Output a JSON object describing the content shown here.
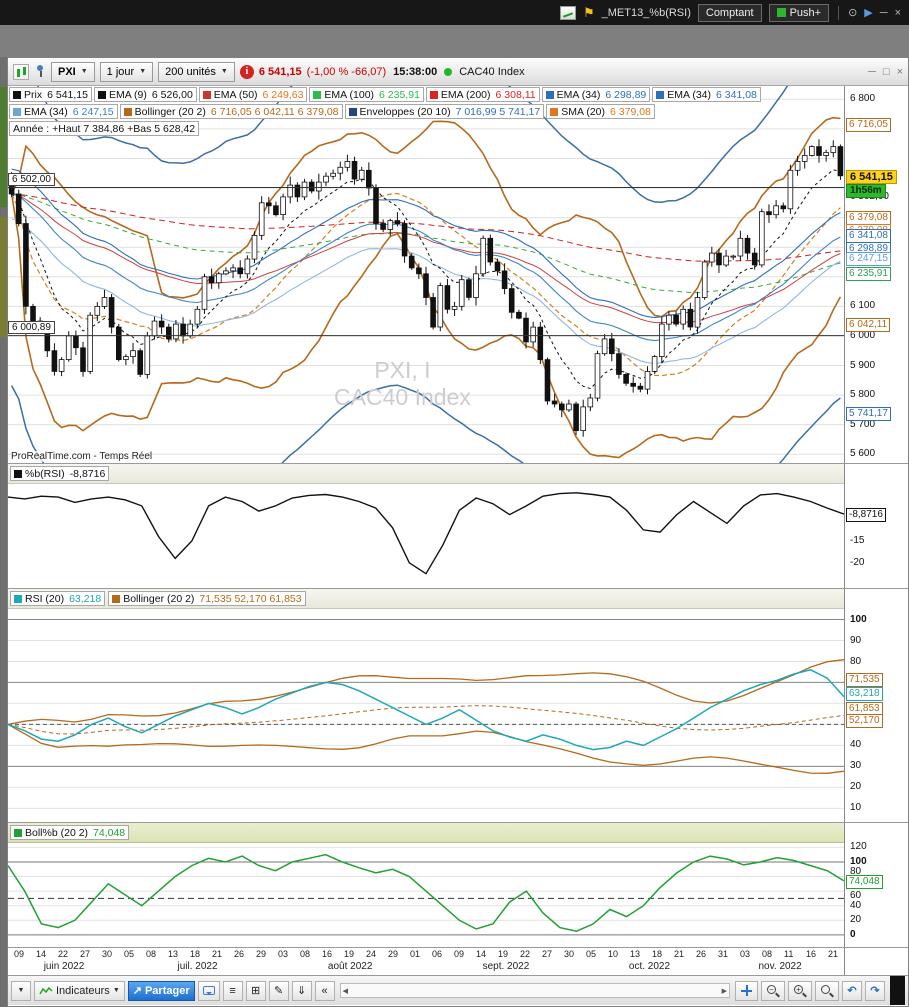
{
  "titlebar": {
    "workspace": "_MET13_%b(RSI)",
    "comptant": "Comptant",
    "push": "Push+"
  },
  "toolbar": {
    "symbol": "PXI",
    "period": "1 jour",
    "units": "200 unités",
    "price": "6 541,15",
    "change": "(-1,00 % -66,07)",
    "time": "15:38:00",
    "index": "CAC40 Index"
  },
  "legend": {
    "row1": [
      {
        "label": "Prix",
        "value": "6 541,15",
        "sq": "#111111",
        "vc": "#111111"
      },
      {
        "label": "EMA (9)",
        "value": "6 526,00",
        "sq": "#111111",
        "vc": "#111111"
      },
      {
        "label": "EMA (50)",
        "value": "6 249,63",
        "sq": "#cc3333",
        "vc": "#e07820"
      },
      {
        "label": "EMA (100)",
        "value": "6 235,91",
        "sq": "#2ebb4e",
        "vc": "#2ebb4e"
      },
      {
        "label": "EMA (200)",
        "value": "6 308,11",
        "sq": "#dd2222",
        "vc": "#dd2222"
      },
      {
        "label": "EMA (34)",
        "value": "6 298,89",
        "sq": "#2f6fba",
        "vc": "#2f6fba"
      },
      {
        "label": "EMA (34)",
        "value": "6 341,08",
        "sq": "#2f6fba",
        "vc": "#2f6fba"
      }
    ],
    "row2": [
      {
        "label": "EMA (34)",
        "value": "6 247,15",
        "sq": "#6aa6d8",
        "vc": "#3a7fc1"
      },
      {
        "label": "Bollinger (20 2)",
        "value": "6 716,05 6 042,11 6 379,08",
        "sq": "#b5691c",
        "vc": "#b5691c"
      },
      {
        "label": "Enveloppes (20 10)",
        "value": "7 016,99 5 741,17",
        "sq": "#24477e",
        "vc": "#2f6fba"
      },
      {
        "label": "SMA (20)",
        "value": "6 379,08",
        "sq": "#e07820",
        "vc": "#e07820"
      }
    ],
    "row3": "Année : +Haut 7 384,86 +Bas 5 628,42"
  },
  "panels": {
    "pb": {
      "label": "%b(RSI)",
      "value": "-8,8716",
      "sq": "#111111",
      "vc": "#111111"
    },
    "rsi": [
      {
        "label": "RSI (20)",
        "value": "63,218",
        "sq": "#1fa8b8",
        "vc": "#1fa8b8"
      },
      {
        "label": "Bollinger (20 2)",
        "value": "71,535 52,170 61,853",
        "sq": "#b5691c",
        "vc": "#b5691c"
      }
    ],
    "bollb": {
      "label": "Boll%b (20 2)",
      "value": "74,048",
      "sq": "#22a033",
      "vc": "#22a033"
    }
  },
  "axes": {
    "main": [
      {
        "text": "6 800",
        "value": 6800,
        "type": "plain"
      },
      {
        "text": "6 716,05",
        "value": 6716.05,
        "type": "chip",
        "color": "#b5691c"
      },
      {
        "text": "6 541,15",
        "value": 6541.15,
        "type": "price"
      },
      {
        "text": "1h56m",
        "value": 6541.15,
        "type": "time",
        "dy": 14
      },
      {
        "text": "6 502,00",
        "value": 6502,
        "type": "plain",
        "dy": 9
      },
      {
        "text": "6 379,08",
        "value": 6379.08,
        "type": "chip",
        "color": "#b5691c",
        "dy": -7
      },
      {
        "text": "6 379,08",
        "value": 6379.08,
        "type": "chip",
        "color": "#e07820",
        "dy": 6
      },
      {
        "text": "6 341,08",
        "value": 6341.08,
        "type": "chip",
        "color": "#2f6fba"
      },
      {
        "text": "6 298,89",
        "value": 6298.89,
        "type": "chip",
        "color": "#2f6fba"
      },
      {
        "text": "6 247,15",
        "value": 6247.15,
        "type": "chip",
        "color": "#5b9bd5",
        "dy": -5
      },
      {
        "text": "6 235,91",
        "value": 6235.91,
        "type": "chip",
        "color": "#2e9e5b",
        "dy": 7
      },
      {
        "text": "6 100",
        "value": 6100,
        "type": "plain"
      },
      {
        "text": "6 042,11",
        "value": 6042.11,
        "type": "chip",
        "color": "#b5691c"
      },
      {
        "text": "6 000",
        "value": 6000,
        "type": "plain"
      },
      {
        "text": "5 900",
        "value": 5900,
        "type": "plain"
      },
      {
        "text": "5 800",
        "value": 5800,
        "type": "plain"
      },
      {
        "text": "5 741,17",
        "value": 5741.17,
        "type": "chip",
        "color": "#2f6fba"
      },
      {
        "text": "5 700",
        "value": 5700,
        "type": "plain"
      },
      {
        "text": "5 600",
        "value": 5600,
        "type": "plain"
      }
    ],
    "pb": [
      {
        "text": "-8,8716",
        "value": -8.8716,
        "type": "chip",
        "color": "#111111"
      },
      {
        "text": "-15",
        "value": -15,
        "type": "plain"
      },
      {
        "text": "-20",
        "value": -20,
        "type": "plain"
      }
    ],
    "rsi": [
      {
        "text": "100",
        "value": 100,
        "type": "plain",
        "bold": true
      },
      {
        "text": "90",
        "value": 90,
        "type": "plain"
      },
      {
        "text": "80",
        "value": 80,
        "type": "plain"
      },
      {
        "text": "71,535",
        "value": 71.535,
        "type": "chip",
        "color": "#b5691c"
      },
      {
        "text": "63,218",
        "value": 63.218,
        "type": "chip",
        "color": "#1fa8b8",
        "dy": -4
      },
      {
        "text": "61,853",
        "value": 61.853,
        "type": "chip",
        "color": "#b5691c",
        "dy": 8
      },
      {
        "text": "52,170",
        "value": 52.17,
        "type": "chip",
        "color": "#b5691c"
      },
      {
        "text": "40",
        "value": 40,
        "type": "plain"
      },
      {
        "text": "30",
        "value": 30,
        "type": "plain"
      },
      {
        "text": "20",
        "value": 20,
        "type": "plain"
      },
      {
        "text": "10",
        "value": 10,
        "type": "plain"
      }
    ],
    "bollb": [
      {
        "text": "120",
        "value": 120,
        "type": "plain"
      },
      {
        "text": "100",
        "value": 100,
        "type": "plain",
        "bold": true
      },
      {
        "text": "80",
        "value": 80,
        "type": "plain",
        "dy": -5
      },
      {
        "text": "74,048",
        "value": 74.048,
        "type": "chip",
        "color": "#22a033"
      },
      {
        "text": "60",
        "value": 60,
        "type": "plain",
        "dy": 5
      },
      {
        "text": "40",
        "value": 40,
        "type": "plain"
      },
      {
        "text": "20",
        "value": 20,
        "type": "plain"
      },
      {
        "text": "0",
        "value": 0,
        "type": "plain",
        "bold": true
      }
    ]
  },
  "watermark": {
    "l1": "PXI, I",
    "l2": "CAC40 Index",
    "credit": "ProRealTime.com - Temps Réel"
  },
  "xaxis": {
    "ticks": [
      "09",
      "14",
      "22",
      "27",
      "30",
      "05",
      "08",
      "13",
      "18",
      "21",
      "26",
      "29",
      "03",
      "08",
      "16",
      "19",
      "24",
      "29",
      "01",
      "06",
      "09",
      "14",
      "19",
      "22",
      "27",
      "30",
      "05",
      "10",
      "13",
      "18",
      "21",
      "26",
      "31",
      "03",
      "08",
      "11",
      "16",
      "21"
    ],
    "months": [
      {
        "label": "juin 2022",
        "frac": 0.075
      },
      {
        "label": "juil. 2022",
        "frac": 0.235
      },
      {
        "label": "août 2022",
        "frac": 0.415
      },
      {
        "label": "sept. 2022",
        "frac": 0.6
      },
      {
        "label": "oct. 2022",
        "frac": 0.775
      },
      {
        "label": "nov. 2022",
        "frac": 0.93
      }
    ]
  },
  "bottom": {
    "indicators": "Indicateurs",
    "share": "Partager"
  },
  "colors": {
    "band_orange": "#b5691c",
    "sma_orange": "#d2811e",
    "envelope_blue": "#3a6ea5",
    "ema34_dark": "#2f6fba",
    "ema34_mid": "#3f85c9",
    "ema34_light": "#8fb8e0",
    "ema50_red": "#cc4040",
    "ema100_green": "#3aa83a",
    "ema200_red": "#cc2222",
    "price_black": "#111111",
    "rsi_cyan": "#1fa8b8",
    "bollb_green": "#22a033",
    "current_chip_yellow": "#ffd21e",
    "time_chip_green": "#2eb82e",
    "quote_red": "#cc0000"
  },
  "chart_data": {
    "type": "candlestick+indicators",
    "symbol": "PXI",
    "index_name": "CAC40 Index",
    "timeframe": "1 jour",
    "units": 200,
    "main": {
      "ylim": [
        5567,
        6845
      ],
      "grid_step": 100,
      "hlines": [
        {
          "value": 6502.0,
          "label": "6 502,00"
        },
        {
          "value": 6000.89,
          "label": "6 000,89"
        }
      ],
      "indicators": [
        "EMA9",
        "EMA34 x3",
        "EMA50",
        "EMA100",
        "EMA200",
        "Bollinger(20,2)",
        "Enveloppes(20,10%)",
        "SMA20"
      ],
      "closes": [
        6480,
        6380,
        6100,
        6050,
        6030,
        5950,
        5880,
        5920,
        6000,
        5960,
        5880,
        6070,
        6100,
        6130,
        6030,
        5920,
        5930,
        5950,
        5870,
        6000,
        6050,
        6030,
        5990,
        6040,
        6000,
        6040,
        6090,
        6200,
        6180,
        6210,
        6220,
        6230,
        6210,
        6260,
        6340,
        6450,
        6440,
        6410,
        6470,
        6510,
        6470,
        6520,
        6490,
        6520,
        6540,
        6550,
        6570,
        6590,
        6530,
        6560,
        6500,
        6380,
        6360,
        6390,
        6380,
        6270,
        6230,
        6210,
        6130,
        6030,
        6170,
        6090,
        6100,
        6190,
        6130,
        6210,
        6330,
        6250,
        6220,
        6160,
        6080,
        6060,
        5980,
        6030,
        5920,
        5780,
        5770,
        5750,
        5770,
        5680,
        5760,
        5790,
        5940,
        5990,
        5940,
        5870,
        5840,
        5830,
        5820,
        5880,
        5930,
        6040,
        6070,
        6040,
        6090,
        6030,
        6130,
        6250,
        6280,
        6240,
        6270,
        6270,
        6330,
        6280,
        6240,
        6420,
        6410,
        6440,
        6430,
        6560,
        6590,
        6610,
        6640,
        6610,
        6620,
        6640,
        6541.15
      ]
    },
    "pb": {
      "ylim": [
        -26,
        -2
      ],
      "series": [
        -5.0,
        -5.4,
        -4.8,
        -5.0,
        -6.2,
        -5.4,
        -5.0,
        -5.6,
        -7.0,
        -14.0,
        -19.0,
        -15.0,
        -7.0,
        -5.0,
        -6.0,
        -8.2,
        -7.0,
        -5.2,
        -4.6,
        -4.4,
        -5.0,
        -6.0,
        -7.5,
        -12.0,
        -20.0,
        -22.5,
        -16.0,
        -8.0,
        -5.2,
        -6.5,
        -9.0,
        -7.0,
        -4.8,
        -4.2,
        -4.0,
        -4.4,
        -5.0,
        -8.0,
        -12.5,
        -13.0,
        -9.0,
        -6.0,
        -8.5,
        -11.0,
        -7.0,
        -4.5,
        -4.2,
        -5.0,
        -6.0,
        -7.5,
        -8.8716
      ]
    },
    "rsi": {
      "ylim": [
        3,
        105
      ],
      "levels": {
        "solid": [
          100,
          70,
          30
        ],
        "dashed": [
          50
        ]
      },
      "series": [
        50,
        47,
        43,
        42,
        45,
        50,
        53,
        49,
        46,
        50,
        54,
        57,
        60,
        58,
        55,
        58,
        62,
        65,
        68,
        70,
        69,
        66,
        62,
        58,
        54,
        50,
        53,
        57,
        52,
        47,
        44,
        42,
        45,
        43,
        40,
        38,
        39,
        42,
        40,
        44,
        48,
        53,
        58,
        62,
        66,
        69,
        71,
        74,
        76,
        72,
        63.218
      ],
      "bollinger_window": 20
    },
    "bollb": {
      "ylim": [
        -18,
        126
      ],
      "levels": {
        "solid": [
          100,
          0
        ],
        "dashed": [
          50
        ],
        "light": [
          120,
          80,
          60,
          40,
          20
        ]
      },
      "series": [
        95,
        60,
        15,
        10,
        20,
        45,
        70,
        55,
        40,
        60,
        80,
        95,
        105,
        100,
        108,
        95,
        88,
        100,
        105,
        110,
        100,
        92,
        85,
        90,
        80,
        60,
        40,
        20,
        8,
        15,
        45,
        60,
        30,
        10,
        5,
        15,
        35,
        25,
        40,
        65,
        85,
        100,
        108,
        104,
        96,
        100,
        106,
        102,
        95,
        88,
        74.048
      ]
    }
  }
}
